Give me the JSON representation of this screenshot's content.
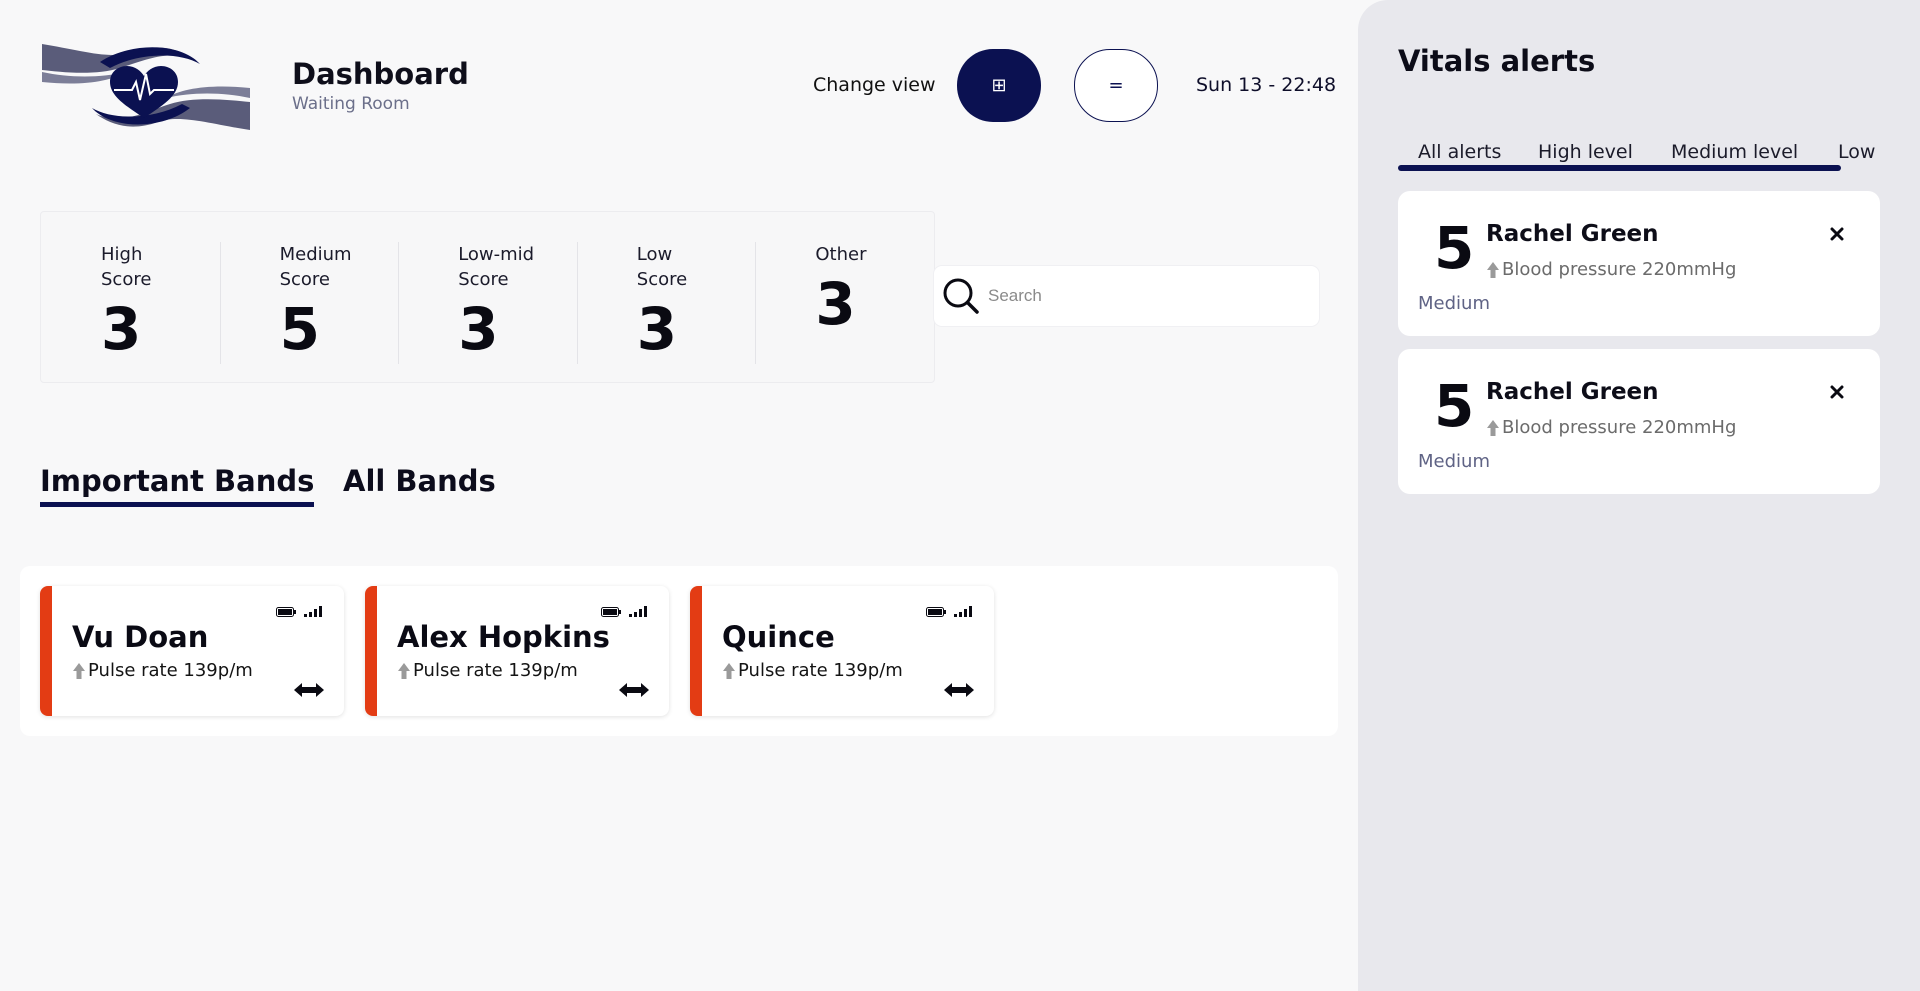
{
  "header": {
    "title": "Dashboard",
    "subtitle": "Waiting Room",
    "change_view_label": "Change view",
    "grid_view_icon": "grid-icon",
    "grid_view_glyph": "⊞",
    "list_view_icon": "list-icon",
    "list_view_glyph": "=",
    "datetime": "Sun 13 - 22:48"
  },
  "scores": [
    {
      "label": "High Score",
      "value": "3"
    },
    {
      "label": "Medium Score",
      "value": "5"
    },
    {
      "label": "Low-mid Score",
      "value": "3"
    },
    {
      "label": "Low Score",
      "value": "3"
    },
    {
      "label": "Other",
      "value": "3"
    }
  ],
  "search": {
    "placeholder": "Search"
  },
  "band_tabs": {
    "important": "Important Bands",
    "all": "All Bands"
  },
  "bands": [
    {
      "name": "Vu Doan",
      "vital": "Pulse rate 139p/m"
    },
    {
      "name": "Alex Hopkins",
      "vital": "Pulse rate 139p/m"
    },
    {
      "name": "Quince",
      "vital": "Pulse rate 139p/m"
    }
  ],
  "sidebar": {
    "title": "Vitals alerts",
    "tabs": [
      "All alerts",
      "High level",
      "Medium level",
      "Low"
    ],
    "alerts": [
      {
        "score": "5",
        "name": "Rachel Green",
        "vital": "Blood pressure 220mmHg",
        "level": "Medium"
      },
      {
        "score": "5",
        "name": "Rachel Green",
        "vital": "Blood pressure 220mmHg",
        "level": "Medium"
      }
    ]
  },
  "colors": {
    "primary": "#0b1151",
    "alert_stripe": "#e33c14",
    "sidebar_bg": "#e8e8ed",
    "page_bg": "#f8f8f9"
  }
}
